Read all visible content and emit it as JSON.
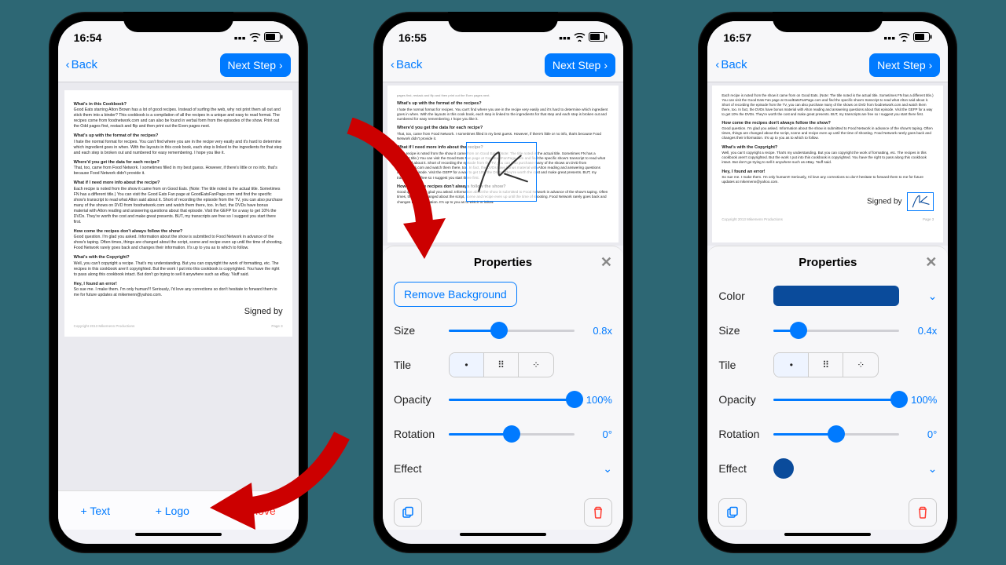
{
  "phones": [
    {
      "time": "16:54"
    },
    {
      "time": "16:55"
    },
    {
      "time": "16:57"
    }
  ],
  "nav": {
    "back": "Back",
    "next": "Next Step"
  },
  "bottombar": {
    "text": "+ Text",
    "logo": "+ Logo",
    "remove": "Remove"
  },
  "panel": {
    "title": "Properties",
    "remove_bg": "Remove Background",
    "labels": {
      "color": "Color",
      "size": "Size",
      "tile": "Tile",
      "opacity": "Opacity",
      "rotation": "Rotation",
      "effect": "Effect"
    },
    "phone2": {
      "size_val": "0.8x",
      "size_pct": 40,
      "opacity_val": "100%",
      "opacity_pct": 100,
      "rotation_val": "0°",
      "rotation_pct": 50
    },
    "phone3": {
      "size_val": "0.4x",
      "size_pct": 20,
      "opacity_val": "100%",
      "opacity_pct": 100,
      "rotation_val": "0°",
      "rotation_pct": 50,
      "color": "#0a4b9b"
    }
  },
  "doc": {
    "signed": "Signed by",
    "footer_left": "Copyright 2013 Mikemenn Productions",
    "footer_right": "Page 3",
    "h1": "What's in this Cookbook?",
    "p1": "Good Eats starring Alton Brown has a lot of good recipes. Instead of surfing the web, why not print them all out and stick them into a binder? This cookbook is a compilation of all the recipes in a unique and easy to read format. The recipes come from foodnetwork.com and can also be found in verbal form from the episodes of the show. Print out the Odd pages first, restack and flip and then print out the Even pages next.",
    "h2": "What's up with the format of the recipes?",
    "p2": "I hate the normal format for recipes. You can't find where you are in the recipe very easily and it's hard to determine which ingredient goes in when. With the layouts in this cook book, each step is linked to the ingredients for that step and each step is broken out and numbered for easy remembering. I hope you like it.",
    "h3": "Where'd you get the data for each recipe?",
    "p3": "That, too, came from Food Network. I sometimes filled in my best guess. However, if there's little or no info, that's because Food Network didn't provide it.",
    "h4": "What if I need more info about the recipe?",
    "p4": "Each recipe is noted from the show it came from on Good Eats. (Note: The title noted is the actual title. Sometimes FN has a different title.) You can visit the Good Eats Fan page at GoodEatsFanPage.com and find the specific show's transcript to read what Alton said about it. Short of recording the episode from the TV, you can also purchase many of the shows on DVD from foodnetwork.com and watch them there, too. In fact, the DVDs have bonus material with Alton reading and answering questions about that episode. Visit the GEFP for a way to get 10% the DVDs. They're worth the cost and make great presents. BUT, my transcripts are free so I suggest you start there first.",
    "h5": "How come the recipes don't always follow the show?",
    "p5": "Good question. I'm glad you asked. Information about the show is submitted to Food Network in advance of the show's taping. Often times, things are changed about the script, scene and recipe even up until the time of shooting. Food Network rarely goes back and changes their information. It's up to you as to which to follow.",
    "h6": "What's with the Copyright?",
    "p6": "Well, you can't copyright a recipe. That's my understanding. But you can copyright the work of formatting, etc. The recipes in this cookbook aren't copyrighted. But the work I put into this cookbook is copyrighted. You have the right to pass along this cookbook intact. But don't go trying to sell it anywhere such as eBay. 'Nuff said.",
    "h7": "Hey, I found an error!",
    "p7": "So sue me. I make them. I'm only human!!! Seriously, I'd love any corrections so don't hesitate to forward them to me for future updates at mikemenn@yahoo.com."
  }
}
